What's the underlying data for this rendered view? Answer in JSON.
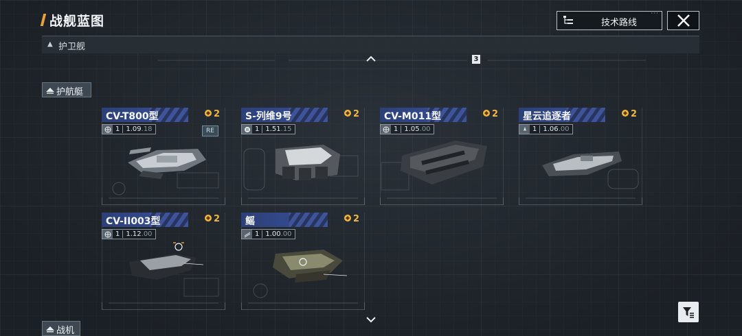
{
  "header": {
    "title": "战舰蓝图",
    "tech_route_label": "技术路线"
  },
  "section": {
    "label": "护卫舰"
  },
  "page_indicator": "3",
  "categories": {
    "current": "护航艇",
    "next": "战机"
  },
  "cards": [
    {
      "name": "CV-T800型",
      "cost": "2",
      "level": "1",
      "version": "1.09",
      "version_sub": ".18",
      "tag": "RE"
    },
    {
      "name": "S-列维9号",
      "cost": "2",
      "level": "1",
      "version": "1.51",
      "version_sub": ".15"
    },
    {
      "name": "CV-M011型",
      "cost": "2",
      "level": "1",
      "version": "1.05",
      "version_sub": ".00"
    },
    {
      "name": "星云追逐者",
      "cost": "2",
      "level": "1",
      "version": "1.06",
      "version_sub": ".00"
    },
    {
      "name": "CV-II003型",
      "cost": "2",
      "level": "1",
      "version": "1.12",
      "version_sub": ".00"
    },
    {
      "name": "鳐",
      "cost": "2",
      "level": "1",
      "version": "1.00",
      "version_sub": ".00"
    }
  ],
  "colors": {
    "accent": "#e9a13b",
    "cost": "#f2b541",
    "namebar": "#2c3f78"
  }
}
